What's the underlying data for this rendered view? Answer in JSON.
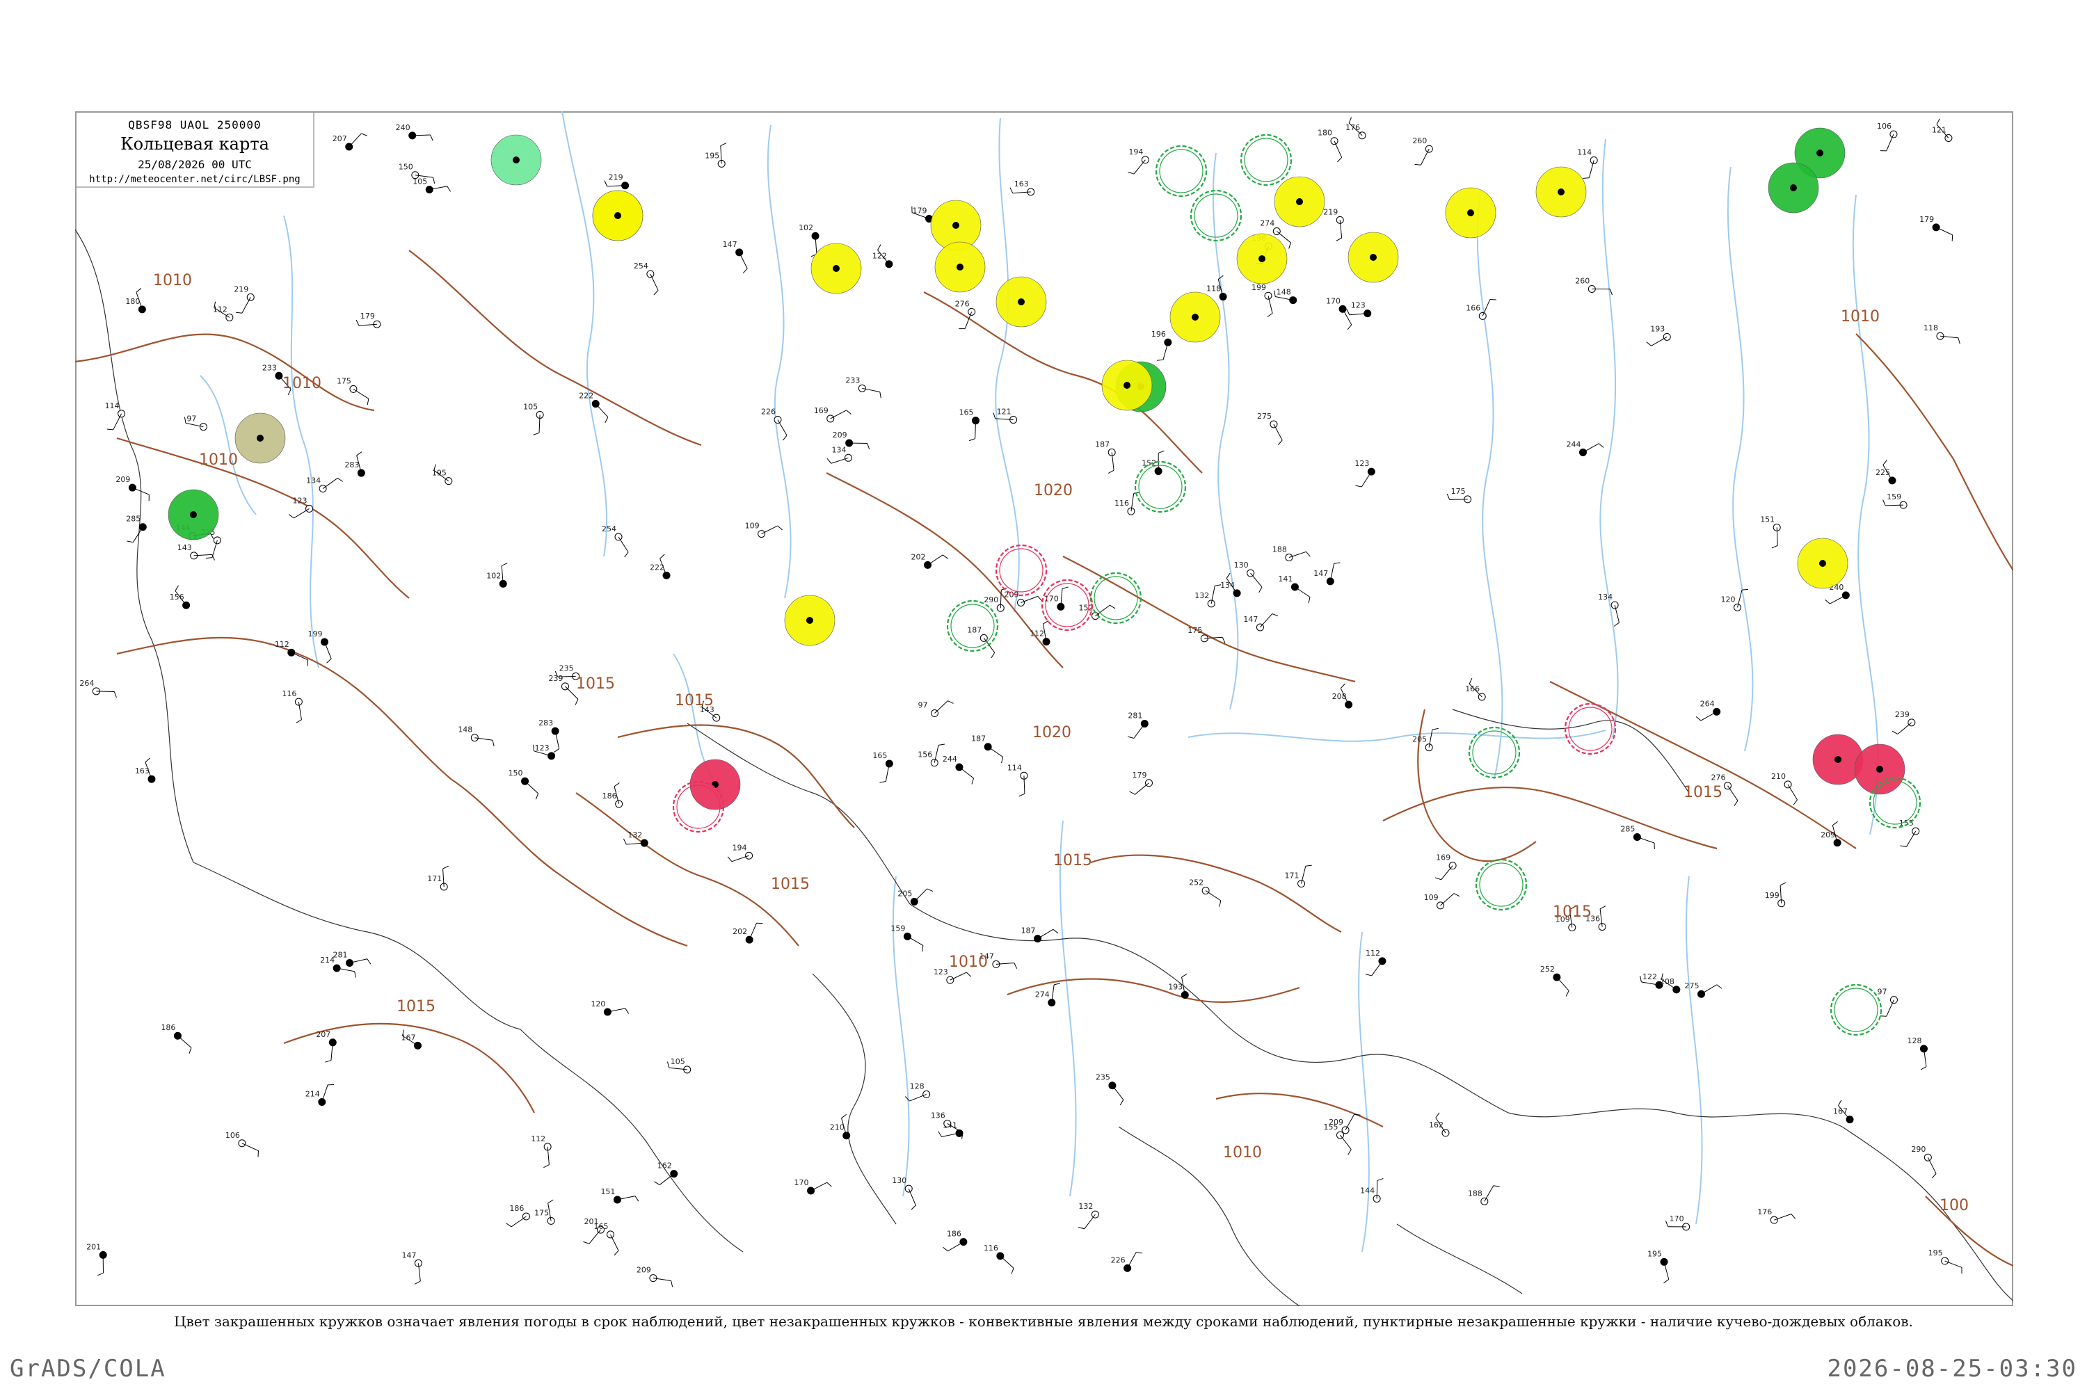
{
  "header": {
    "code": "QBSF98 UAOL 250000",
    "title": "Кольцевая карта",
    "time": "25/08/2026 00 UTC",
    "url": "http://meteocenter.net/circ/LBSF.png"
  },
  "isobars": [
    {
      "label": "1010"
    },
    {
      "label": "1010"
    },
    {
      "label": "1010"
    },
    {
      "label": "1015"
    },
    {
      "label": "1015"
    },
    {
      "label": "1015"
    },
    {
      "label": "1015"
    },
    {
      "label": "1020"
    },
    {
      "label": "1020"
    },
    {
      "label": "1010"
    },
    {
      "label": "1015"
    },
    {
      "label": "1015"
    },
    {
      "label": "1015"
    },
    {
      "label": "1010"
    },
    {
      "label": "1010"
    },
    {
      "label": "100"
    }
  ],
  "station_circles": [
    {
      "type": "filled",
      "color": "#6fe89a"
    },
    {
      "type": "filled",
      "color": "#f5f500"
    },
    {
      "type": "filled",
      "color": "#f5f500"
    },
    {
      "type": "filled",
      "color": "#c2c08a"
    },
    {
      "type": "filled",
      "color": "#22bb33"
    },
    {
      "type": "filled",
      "color": "#f5f500"
    },
    {
      "type": "filled",
      "color": "#f5f500"
    },
    {
      "type": "filled",
      "color": "#f5f500"
    },
    {
      "type": "filled",
      "color": "#f5f500"
    },
    {
      "type": "filled",
      "color": "#f5f500"
    },
    {
      "type": "filled",
      "color": "#22bb33"
    },
    {
      "type": "filled",
      "color": "#f5f500"
    },
    {
      "type": "filled",
      "color": "#f5f500"
    },
    {
      "type": "filled",
      "color": "#f5f500"
    },
    {
      "type": "filled",
      "color": "#f5f500"
    },
    {
      "type": "filled",
      "color": "#f5f500"
    },
    {
      "type": "filled",
      "color": "#f5f500"
    },
    {
      "type": "filled",
      "color": "#f5f500"
    },
    {
      "type": "filled",
      "color": "#22bb33"
    },
    {
      "type": "filled",
      "color": "#22bb33"
    },
    {
      "type": "filled",
      "color": "#f5f500"
    },
    {
      "type": "filled",
      "color": "#e8305a"
    },
    {
      "type": "filled",
      "color": "#e8305a"
    },
    {
      "type": "filled",
      "color": "#e8305a"
    },
    {
      "type": "outline",
      "color": "#22aa44"
    },
    {
      "type": "outline",
      "color": "#22aa44"
    },
    {
      "type": "outline",
      "color": "#22aa44"
    },
    {
      "type": "outline",
      "color": "#22aa44"
    },
    {
      "type": "outline",
      "color": "#22aa44"
    },
    {
      "type": "outline",
      "color": "#22aa44"
    },
    {
      "type": "outline",
      "color": "#22aa44"
    },
    {
      "type": "outline",
      "color": "#22aa44"
    },
    {
      "type": "outline",
      "color": "#e8305a"
    },
    {
      "type": "outline",
      "color": "#e8305a"
    },
    {
      "type": "outline",
      "color": "#e8305a"
    },
    {
      "type": "outline",
      "color": "#e8305a"
    },
    {
      "type": "outline",
      "color": "#22aa44"
    },
    {
      "type": "outline",
      "color": "#22aa44"
    }
  ],
  "station_numbers": [
    "114",
    "97",
    "132",
    "219",
    "123",
    "105",
    "199",
    "165",
    "147",
    "116",
    "109",
    "112",
    "134",
    "175",
    "156",
    "159",
    "128",
    "222",
    "120",
    "167",
    "194",
    "102",
    "201",
    "175",
    "141",
    "207",
    "180",
    "209",
    "150",
    "235",
    "163",
    "225",
    "260",
    "274",
    "290",
    "123",
    "169",
    "106",
    "195",
    "202",
    "152",
    "208",
    "186",
    "187",
    "226",
    "179",
    "147",
    "112",
    "143",
    "170",
    "148",
    "239",
    "171",
    "162",
    "193",
    "210",
    "121",
    "195",
    "244",
    "233",
    "214",
    "187",
    "166",
    "176",
    "134",
    "281",
    "254",
    "209",
    "186",
    "155",
    "179",
    "122",
    "130",
    "170",
    "136",
    "151",
    "144",
    "285",
    "276",
    "283",
    "252",
    "264",
    "196",
    "205",
    "240",
    "275",
    "209",
    "188",
    "118"
  ],
  "caption": "Цвет закрашенных кружков означает явления погоды в срок наблюдений, цвет незакрашенных кружков - конвективные явления между сроками наблюдений, пунктирные незакрашенные кружки - наличие кучево-дождевых облаков.",
  "footer": {
    "left": "GrADS/COLA",
    "right": "2026-08-25-03:30"
  },
  "colors": {
    "isobar": "#a0522d",
    "river": "#9ecbf0",
    "coast": "#333333"
  }
}
